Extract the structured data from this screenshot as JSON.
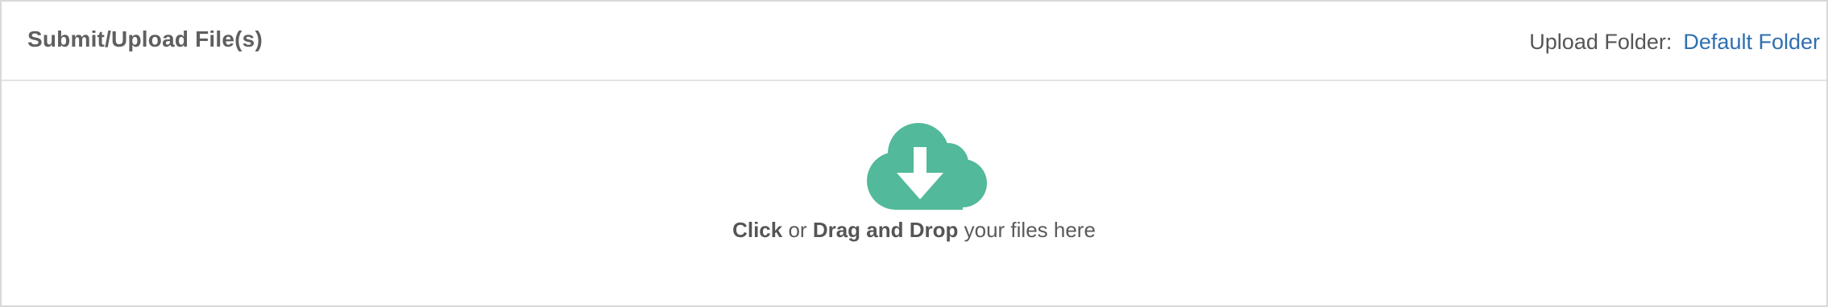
{
  "header": {
    "title": "Submit/Upload File(s)",
    "upload_folder_label": "Upload Folder:",
    "upload_folder_value": "Default Folder"
  },
  "dropzone": {
    "icon": "cloud-download-icon",
    "click_text": "Click",
    "or_text": "or",
    "drag_text": "Drag and Drop",
    "suffix_text": "your files here"
  },
  "colors": {
    "cloud_icon": "#52b99a",
    "link": "#2f6fb0",
    "text": "#555555",
    "border": "#d9d9d9"
  }
}
